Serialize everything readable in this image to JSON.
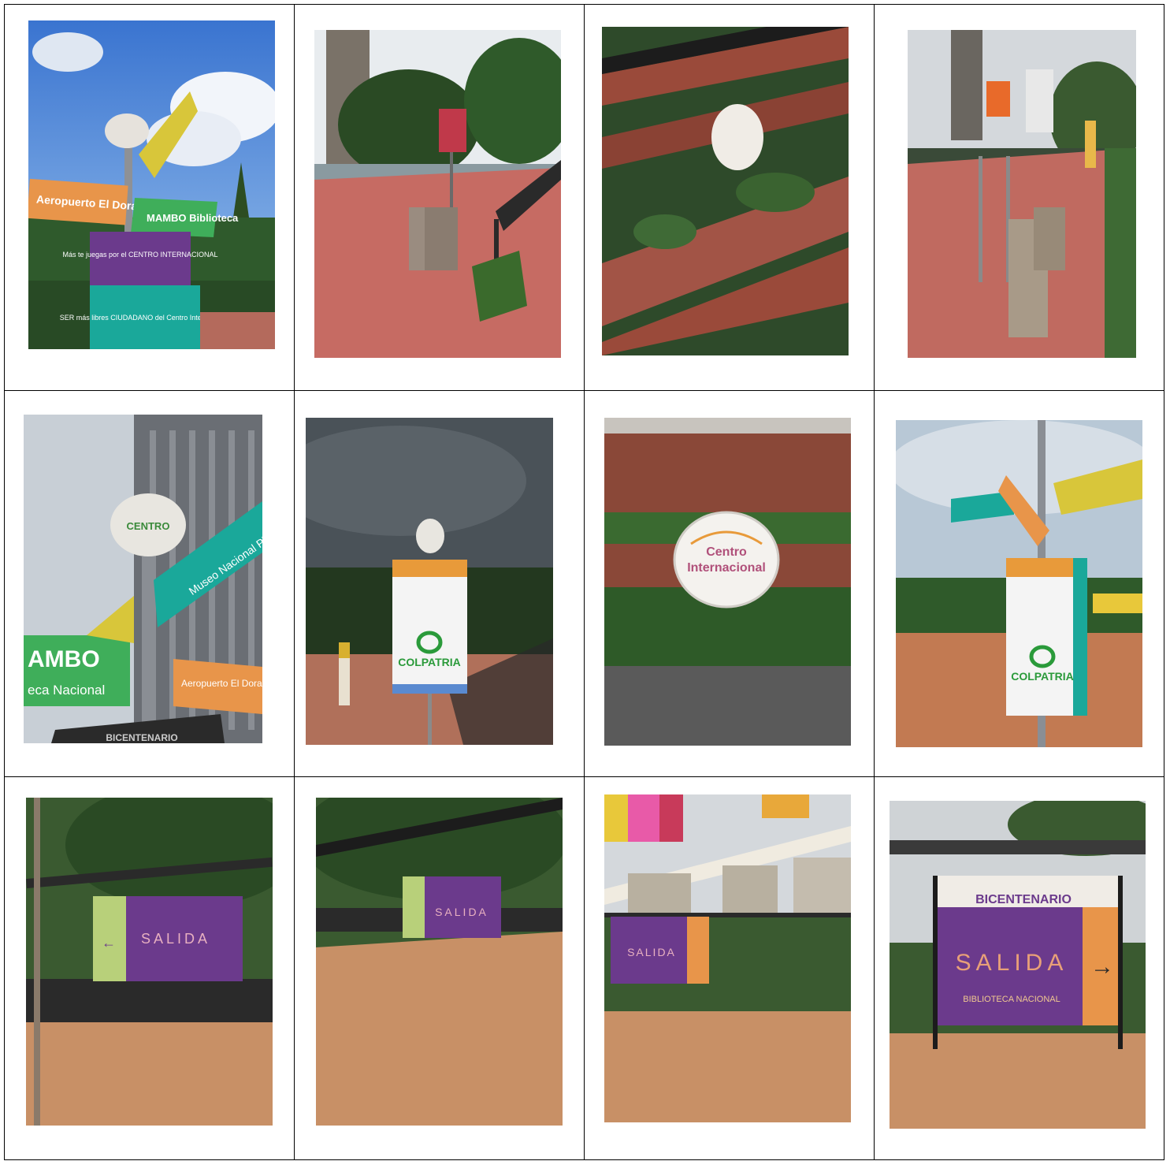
{
  "photos": [
    {
      "row": 1,
      "col": 1,
      "signs": {
        "top_left": "Aeropuerto El Dorado",
        "top_right": "MAMBO Biblioteca",
        "purple": "Más te juegas por el CENTRO INTERNACIONAL",
        "teal": "SER más libres CIUDADANO del Centro Internacional"
      }
    },
    {
      "row": 1,
      "col": 2
    },
    {
      "row": 1,
      "col": 3
    },
    {
      "row": 1,
      "col": 4
    },
    {
      "row": 2,
      "col": 1,
      "signs": {
        "disk": "CENTRO",
        "teal": "Museo Nacional Planetario",
        "green": "AMBO",
        "green2": "eca Nacional",
        "orange": "Aeropuerto El Dorado",
        "bottom": "BICENTENARIO"
      }
    },
    {
      "row": 2,
      "col": 2,
      "signs": {
        "brand": "COLPATRIA"
      }
    },
    {
      "row": 2,
      "col": 3,
      "signs": {
        "logo1": "Centro",
        "logo2": "Internacional"
      }
    },
    {
      "row": 2,
      "col": 4,
      "signs": {
        "brand": "COLPATRIA"
      }
    },
    {
      "row": 3,
      "col": 1,
      "signs": {
        "banner": "SALIDA",
        "arrow": "←"
      }
    },
    {
      "row": 3,
      "col": 2,
      "signs": {
        "banner": "SALIDA"
      }
    },
    {
      "row": 3,
      "col": 3,
      "signs": {
        "banner": "SALIDA"
      }
    },
    {
      "row": 3,
      "col": 4,
      "signs": {
        "park": "BICENTENARIO",
        "banner": "SALIDA",
        "sub": "BIBLIOTECA NACIONAL",
        "arrow": "→"
      }
    }
  ],
  "colors": {
    "purple": "#6b3a8c",
    "teal": "#1aa89a",
    "green": "#3fae5a",
    "orange": "#e8954a",
    "brick": "#c0615e",
    "wood": "#9a4a3a",
    "wall": "#c89066"
  }
}
